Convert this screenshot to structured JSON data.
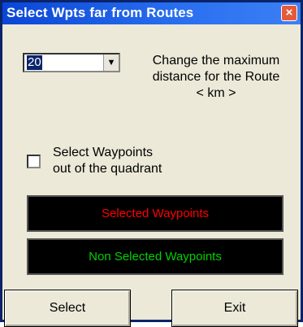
{
  "window": {
    "title": "Select Wpts far from Routes",
    "close_glyph": "×"
  },
  "distance": {
    "value": "20",
    "dropdown_glyph": "▼"
  },
  "hint": [
    "Change the maximum",
    "distance for the Route",
    "< km >"
  ],
  "checkbox": {
    "label_line1": "Select Waypoints",
    "label_line2": "out of the quadrant",
    "checked": false
  },
  "panels": {
    "selected": "Selected Waypoints",
    "non_selected": "Non Selected Waypoints"
  },
  "buttons": {
    "select": "Select",
    "exit": "Exit"
  },
  "colors": {
    "title_bar": "#0a46d6",
    "selected_text": "#ff0000",
    "non_selected_text": "#00d000",
    "panel_bg": "#000000"
  }
}
